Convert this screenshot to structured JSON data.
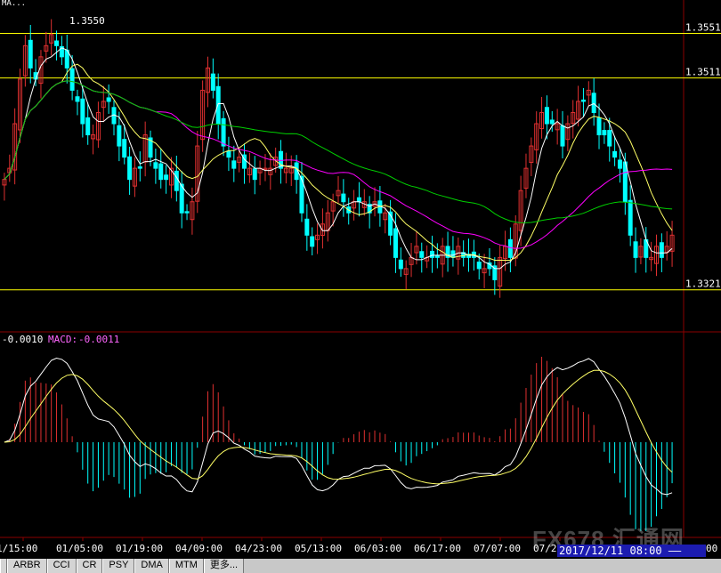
{
  "price_panel": {
    "top_label": "MA...",
    "high_marker": "1.3550",
    "levels": [
      {
        "label": "1.3551",
        "value": 1.3551
      },
      {
        "label": "1.3511",
        "value": 1.3511
      },
      {
        "label": "1.3321",
        "value": 1.3321
      }
    ]
  },
  "macd_panel": {
    "legend_diff": "-0.0010",
    "legend_macd_label": "MACD:",
    "legend_macd_value": "-0.0011"
  },
  "x_axis": {
    "ticks": [
      "1/15:00",
      "01/05:00",
      "01/19:00",
      "04/09:00",
      "04/23:00",
      "05/13:00",
      "06/03:00",
      "06/17:00",
      "07/07:00",
      "07/21"
    ],
    "last_tick": "00"
  },
  "cursor_date": "2017/12/11 08:00 ——",
  "watermark": "FX678 汇通网",
  "indicator_tabs": [
    "ARBR",
    "CCI",
    "CR",
    "PSY",
    "DMA",
    "MTM",
    "更多..."
  ],
  "colors": {
    "background": "#000000",
    "bull": "#e03030",
    "bear": "#00ffff",
    "ma_fast": "#ffffff",
    "ma_mid": "#ffff66",
    "ma_slow": "#ff00ff",
    "ma_long": "#00d000",
    "level_line": "#ffff00",
    "grid": "#8b0000",
    "macd_dif": "#ffffff",
    "macd_dea": "#ffff66"
  },
  "chart_data": {
    "type": "candlestick+macd",
    "price_axis_labels": [
      1.3551,
      1.3511,
      1.3321
    ],
    "close_series": [
      1.342,
      1.343,
      1.347,
      1.351,
      1.354,
      1.352,
      1.351,
      1.353,
      1.354,
      1.355,
      1.354,
      1.353,
      1.352,
      1.35,
      1.349,
      1.347,
      1.346,
      1.346,
      1.348,
      1.349,
      1.349,
      1.347,
      1.345,
      1.344,
      1.342,
      1.343,
      1.343,
      1.346,
      1.344,
      1.343,
      1.342,
      1.342,
      1.343,
      1.341,
      1.339,
      1.339,
      1.34,
      1.345,
      1.35,
      1.352,
      1.35,
      1.347,
      1.345,
      1.344,
      1.343,
      1.344,
      1.343,
      1.343,
      1.342,
      1.343,
      1.343,
      1.343,
      1.344,
      1.343,
      1.343,
      1.343,
      1.342,
      1.339,
      1.337,
      1.336,
      1.337,
      1.338,
      1.339,
      1.34,
      1.341,
      1.34,
      1.339,
      1.34,
      1.34,
      1.34,
      1.339,
      1.34,
      1.339,
      1.339,
      1.337,
      1.335,
      1.334,
      1.334,
      1.335,
      1.336,
      1.335,
      1.335,
      1.335,
      1.335,
      1.336,
      1.335,
      1.335,
      1.336,
      1.335,
      1.335,
      1.335,
      1.334,
      1.334,
      1.334,
      1.333,
      1.335,
      1.336,
      1.335,
      1.338,
      1.341,
      1.343,
      1.345,
      1.347,
      1.348,
      1.347,
      1.347,
      1.347,
      1.345,
      1.347,
      1.348,
      1.349,
      1.349,
      1.35,
      1.348,
      1.346,
      1.346,
      1.345,
      1.344,
      1.343,
      1.34,
      1.337,
      1.335,
      1.336,
      1.335,
      1.335,
      1.336,
      1.335,
      1.336,
      1.337
    ]
  }
}
